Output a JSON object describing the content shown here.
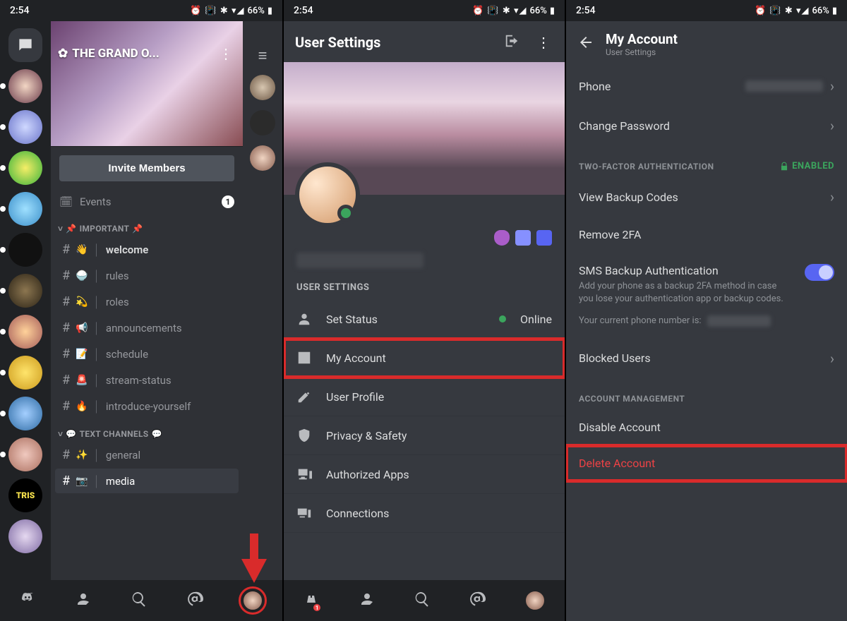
{
  "status_bar": {
    "time": "2:54",
    "battery": "66%",
    "icons": "⏰ 📳 ✱ ▾◢"
  },
  "panel1": {
    "server_name": "THE GRAND O...",
    "invite_label": "Invite Members",
    "events": {
      "label": "Events",
      "count": "1"
    },
    "cat_important": "IMPORTANT",
    "cat_text": "TEXT CHANNELS",
    "channels": {
      "welcome": "welcome",
      "rules": "rules",
      "roles": "roles",
      "announcements": "announcements",
      "schedule": "schedule",
      "stream_status": "stream-status",
      "introduce": "introduce-yourself",
      "general": "general",
      "media": "media"
    }
  },
  "panel2": {
    "title": "User Settings",
    "section": "USER SETTINGS",
    "items": {
      "set_status": "Set Status",
      "status_value": "Online",
      "my_account": "My Account",
      "user_profile": "User Profile",
      "privacy": "Privacy & Safety",
      "authorized": "Authorized Apps",
      "connections": "Connections"
    }
  },
  "panel3": {
    "title": "My Account",
    "subtitle": "User Settings",
    "phone": "Phone",
    "change_password": "Change Password",
    "two_factor_section": "TWO-FACTOR AUTHENTICATION",
    "enabled": "ENABLED",
    "view_codes": "View Backup Codes",
    "remove_2fa": "Remove 2FA",
    "sms_backup": "SMS Backup Authentication",
    "sms_desc": "Add your phone as a backup 2FA method in case you lose your authentication app or backup codes.",
    "current_phone": "Your current phone number is:",
    "blocked": "Blocked Users",
    "acct_mgmt": "ACCOUNT MANAGEMENT",
    "disable": "Disable Account",
    "delete": "Delete Account"
  }
}
